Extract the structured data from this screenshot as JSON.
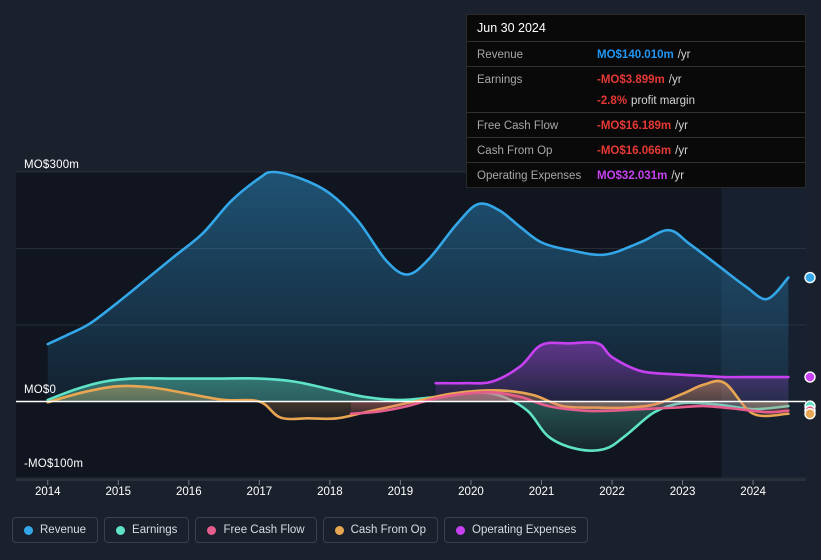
{
  "chart_data": {
    "type": "area",
    "title": "",
    "xlabel": "",
    "ylabel": "",
    "currency": "MO$",
    "unit": "m",
    "ylim": [
      -100,
      300
    ],
    "xlim": [
      2013.55,
      2024.75
    ],
    "grid": true,
    "y_ticks": [
      {
        "value": 300,
        "label": "MO$300m"
      },
      {
        "value": 200,
        "label": ""
      },
      {
        "value": 100,
        "label": ""
      },
      {
        "value": 0,
        "label": "MO$0"
      },
      {
        "value": -100,
        "label": "-MO$100m"
      }
    ],
    "x_ticks": [
      {
        "value": 2014,
        "label": "2014"
      },
      {
        "value": 2015,
        "label": "2015"
      },
      {
        "value": 2016,
        "label": "2016"
      },
      {
        "value": 2017,
        "label": "2017"
      },
      {
        "value": 2018,
        "label": "2018"
      },
      {
        "value": 2019,
        "label": "2019"
      },
      {
        "value": 2020,
        "label": "2020"
      },
      {
        "value": 2021,
        "label": "2021"
      },
      {
        "value": 2022,
        "label": "2022"
      },
      {
        "value": 2023,
        "label": "2023"
      },
      {
        "value": 2024,
        "label": "2024"
      }
    ],
    "forecast_start": 2023.55,
    "legend_position": "bottom",
    "series": [
      {
        "name": "Revenue",
        "color": "#33a7e8",
        "x": [
          2014.0,
          2014.3,
          2014.6,
          2015.0,
          2015.4,
          2015.8,
          2016.2,
          2016.6,
          2017.0,
          2017.2,
          2017.6,
          2018.0,
          2018.4,
          2018.8,
          2019.1,
          2019.4,
          2019.8,
          2020.1,
          2020.4,
          2020.7,
          2021.0,
          2021.4,
          2021.9,
          2022.4,
          2022.8,
          2023.1,
          2023.5,
          2023.9,
          2024.2,
          2024.5
        ],
        "values": [
          75,
          88,
          102,
          130,
          160,
          190,
          220,
          262,
          292,
          300,
          291,
          272,
          236,
          184,
          166,
          186,
          232,
          258,
          250,
          228,
          208,
          198,
          192,
          208,
          224,
          206,
          178,
          150,
          134,
          162
        ]
      },
      {
        "name": "Earnings",
        "color": "#5fe3c6",
        "x": [
          2014.0,
          2014.4,
          2014.8,
          2015.2,
          2015.8,
          2016.4,
          2017.0,
          2017.5,
          2018.0,
          2018.5,
          2019.0,
          2019.5,
          2020.0,
          2020.4,
          2020.8,
          2021.1,
          2021.5,
          2021.9,
          2022.2,
          2022.6,
          2023.0,
          2023.5,
          2024.0,
          2024.5
        ],
        "values": [
          2,
          16,
          26,
          30,
          30,
          30,
          30,
          26,
          16,
          6,
          2,
          6,
          12,
          8,
          -12,
          -46,
          -62,
          -62,
          -44,
          -14,
          -2,
          -4,
          -10,
          -6
        ]
      },
      {
        "name": "Free Cash Flow",
        "color": "#e55d8c",
        "x": [
          2018.3,
          2018.7,
          2019.1,
          2019.5,
          2019.9,
          2020.3,
          2020.7,
          2021.1,
          2021.6,
          2022.0,
          2022.4,
          2022.9,
          2023.3,
          2023.8,
          2024.2,
          2024.5
        ],
        "values": [
          -16,
          -13,
          -6,
          4,
          10,
          12,
          6,
          -6,
          -12,
          -12,
          -10,
          -8,
          -6,
          -10,
          -14,
          -12
        ]
      },
      {
        "name": "Cash From Op",
        "color": "#e8a652",
        "x": [
          2014.0,
          2014.5,
          2015.0,
          2015.5,
          2016.0,
          2016.5,
          2017.0,
          2017.3,
          2017.7,
          2018.1,
          2018.5,
          2018.9,
          2019.3,
          2019.7,
          2020.1,
          2020.5,
          2020.9,
          2021.3,
          2021.8,
          2022.2,
          2022.6,
          2023.0,
          2023.3,
          2023.6,
          2024.0,
          2024.5
        ],
        "values": [
          -1,
          12,
          20,
          18,
          10,
          2,
          0,
          -21,
          -22,
          -22,
          -14,
          -6,
          2,
          10,
          14,
          14,
          8,
          -6,
          -8,
          -8,
          -4,
          10,
          22,
          24,
          -16,
          -16
        ]
      },
      {
        "name": "Operating Expenses",
        "color": "#c641f0",
        "x": [
          2019.5,
          2019.9,
          2020.3,
          2020.7,
          2021.0,
          2021.4,
          2021.8,
          2022.0,
          2022.4,
          2022.8,
          2023.2,
          2023.6,
          2024.0,
          2024.5
        ],
        "values": [
          24,
          24,
          26,
          46,
          74,
          76,
          76,
          58,
          40,
          36,
          34,
          32,
          32,
          32
        ]
      }
    ]
  },
  "tooltip": {
    "title": "Jun 30 2024",
    "rows": [
      {
        "key": "Revenue",
        "value": "MO$140.010m",
        "unit": "/yr",
        "color": "#2196f3"
      },
      {
        "key": "Earnings",
        "value": "-MO$3.899m",
        "unit": "/yr",
        "color": "#e53935"
      },
      {
        "key": "",
        "value": "-2.8%",
        "unit": "profit margin",
        "color": "#e53935"
      },
      {
        "key": "Free Cash Flow",
        "value": "-MO$16.189m",
        "unit": "/yr",
        "color": "#e53935"
      },
      {
        "key": "Cash From Op",
        "value": "-MO$16.066m",
        "unit": "/yr",
        "color": "#e53935"
      },
      {
        "key": "Operating Expenses",
        "value": "MO$32.031m",
        "unit": "/yr",
        "color": "#c641f0"
      }
    ]
  },
  "legend": {
    "items": [
      {
        "label": "Revenue",
        "color": "#33a7e8"
      },
      {
        "label": "Earnings",
        "color": "#5fe3c6"
      },
      {
        "label": "Free Cash Flow",
        "color": "#e55d8c"
      },
      {
        "label": "Cash From Op",
        "color": "#e8a652"
      },
      {
        "label": "Operating Expenses",
        "color": "#c641f0"
      }
    ]
  },
  "colors": {
    "background": "#1b212c",
    "plot_background": "#10151f",
    "gridline": "#39414e",
    "zero_line": "#ffffff",
    "forecast_band": "#16202e"
  }
}
